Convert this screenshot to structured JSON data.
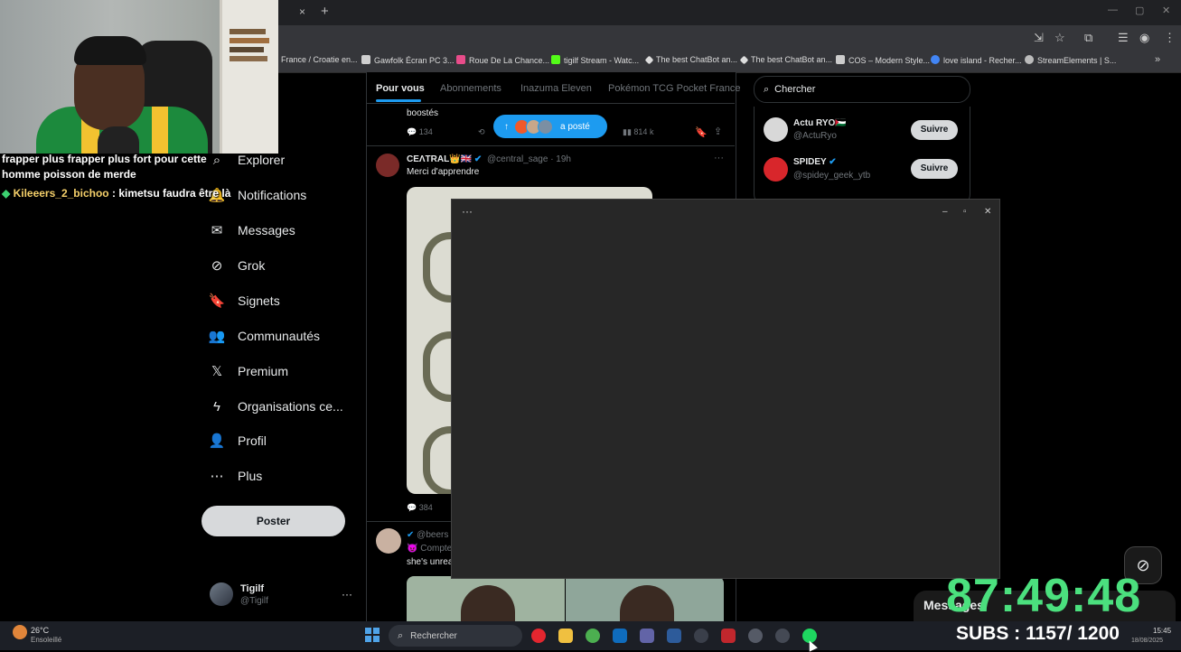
{
  "browser": {
    "tab_close": "×",
    "new_tab": "+",
    "bookmarks": [
      {
        "label": "France / Croatie en...",
        "color": "#35363a"
      },
      {
        "label": "Gawfolk Écran PC 3...",
        "color": "#cfcfcf"
      },
      {
        "label": "Roue De La Chance...",
        "color": "#e84c8a"
      },
      {
        "label": "tigilf Stream - Watc...",
        "color": "#53fc18"
      },
      {
        "label": "The best ChatBot an...",
        "color": "#dddddd"
      },
      {
        "label": "The best ChatBot an...",
        "color": "#dddddd"
      },
      {
        "label": "COS – Modern Style...",
        "color": "#cccccc"
      },
      {
        "label": "love island - Recher...",
        "color": "#4285f4"
      },
      {
        "label": "StreamElements | S...",
        "color": "#bbbbbb"
      }
    ],
    "bookmarks_more": "»"
  },
  "chat": {
    "message1": "frapper plus frapper plus fort pour cette homme poisson de merde",
    "message2_diamond": "◆",
    "message2_user": "Kileeers_2_bichoo",
    "message2_text": ": kimetsu faudra être là"
  },
  "nav": {
    "items": [
      {
        "label": "Explorer",
        "icon": "⌕"
      },
      {
        "label": "Notifications",
        "icon": "🔔"
      },
      {
        "label": "Messages",
        "icon": "✉"
      },
      {
        "label": "Grok",
        "icon": "⊘"
      },
      {
        "label": "Signets",
        "icon": "🔖"
      },
      {
        "label": "Communautés",
        "icon": "👥"
      },
      {
        "label": "Premium",
        "icon": "𝕏"
      },
      {
        "label": "Organisations ce...",
        "icon": "ϟ"
      },
      {
        "label": "Profil",
        "icon": "👤"
      },
      {
        "label": "Plus",
        "icon": "⋯"
      }
    ],
    "post_button": "Poster",
    "profile_name": "Tigilf",
    "profile_handle": "@Tigilf",
    "profile_more": "···"
  },
  "feed": {
    "tabs": [
      "Pour vous",
      "Abonnements",
      "Inazuma Eleven",
      "Pokémon TCG Pocket France"
    ],
    "prev_post_text": "boostés",
    "prev_post_replies": "134",
    "prev_post_views": "814 k",
    "new_posts_pill": "a posté",
    "post1": {
      "name": "CEΛTRAL👑🇬🇧",
      "handle": "@central_sage · 19h",
      "text": "Merci d'apprendre",
      "replies": "384",
      "more": "···"
    },
    "post2": {
      "handle": "@beers",
      "sub": "😈 Compte",
      "text": "she's unrea"
    }
  },
  "sidebar": {
    "search_placeholder": "Chercher",
    "suggestions": [
      {
        "name": "Actu RYO🇵🇸",
        "handle": "@ActuRyo",
        "follow": "Suivre",
        "avatar_color": "#d8d8d8"
      },
      {
        "name": "SPIDEY",
        "handle": "@spidey_geek_ytb",
        "follow": "Suivre",
        "avatar_color": "#d8262b"
      }
    ]
  },
  "popup": {
    "menu": "···",
    "minimize": "–",
    "maximize": "▫",
    "close": "✕"
  },
  "overlay": {
    "timer": "87:49:48",
    "subs": "SUBS : 1157/ 1200",
    "messages": "Messages"
  },
  "taskbar": {
    "weather_temp": "26°C",
    "weather_desc": "Ensoleillé",
    "search": "Rechercher",
    "time": "15:45",
    "date": "18/08/2025",
    "apps": [
      {
        "name": "opera",
        "color": "#e3262f"
      },
      {
        "name": "explorer",
        "color": "#f0c040"
      },
      {
        "name": "chrome",
        "color": "#4caf50"
      },
      {
        "name": "outlook",
        "color": "#0f6cbd"
      },
      {
        "name": "teams",
        "color": "#6264a7"
      },
      {
        "name": "app-blue",
        "color": "#2d5b9a"
      },
      {
        "name": "app-dark",
        "color": "#3a3f4a"
      },
      {
        "name": "app-red",
        "color": "#c1272d"
      },
      {
        "name": "obs",
        "color": "#555a66"
      },
      {
        "name": "media",
        "color": "#444954"
      },
      {
        "name": "spotify",
        "color": "#1ed760"
      }
    ]
  }
}
